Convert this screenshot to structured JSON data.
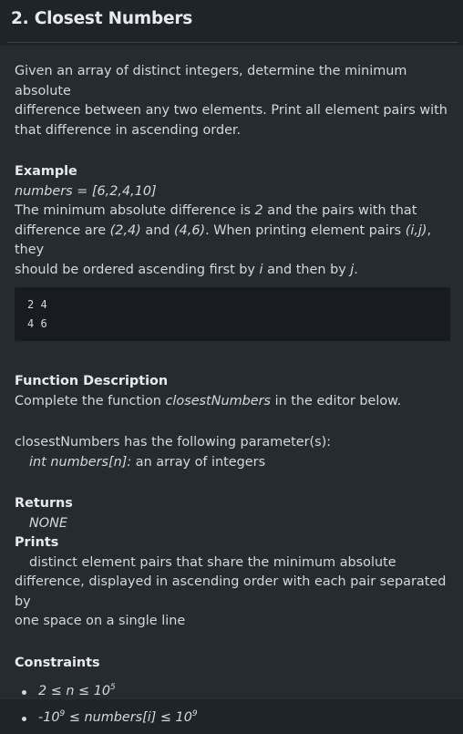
{
  "header": {
    "title": "2. Closest Numbers"
  },
  "description": {
    "line1": "Given an array of distinct integers, determine the minimum absolute",
    "line2": "difference between any two elements. Print all element pairs with",
    "line3": "that difference in ascending order."
  },
  "example": {
    "heading": "Example",
    "numbers_label": "numbers",
    "numbers_eq": " = [6,2,4,10]",
    "sentence": {
      "a": "The minimum absolute difference is ",
      "b": "2",
      "c": " and the pairs with that",
      "d": "difference are ",
      "e": "(2,4)",
      "f": " and ",
      "g": "(4,6)",
      "h": ". When printing element pairs ",
      "i": "(i,j)",
      "j": ", they",
      "k": "should be ordered ascending first by ",
      "l": "i",
      "m": " and then by ",
      "n": "j",
      "o": "."
    },
    "output_lines": [
      "2 4",
      "4 6"
    ]
  },
  "function_description": {
    "heading": "Function Description",
    "a": "Complete the function ",
    "fn": "closestNumbers",
    "b": " in the editor below.",
    "params_intro": "closestNumbers has the following parameter(s):",
    "param_name": "int numbers[n]:",
    "param_desc": "  an array of integers"
  },
  "returns": {
    "heading": "Returns",
    "value": "NONE"
  },
  "prints": {
    "heading": "Prints",
    "line1": "distinct element pairs that share the minimum absolute",
    "line2": "difference, displayed in ascending order with each pair separated by",
    "line3": "one space on a single line"
  },
  "constraints": {
    "heading": "Constraints",
    "c1_base": "2 ≤ n ≤ 10",
    "c1_exp": "5",
    "c2_pre": "-10",
    "c2_exp1": "9",
    "c2_mid": " ≤ numbers[i] ≤ 10",
    "c2_exp2": "9"
  }
}
